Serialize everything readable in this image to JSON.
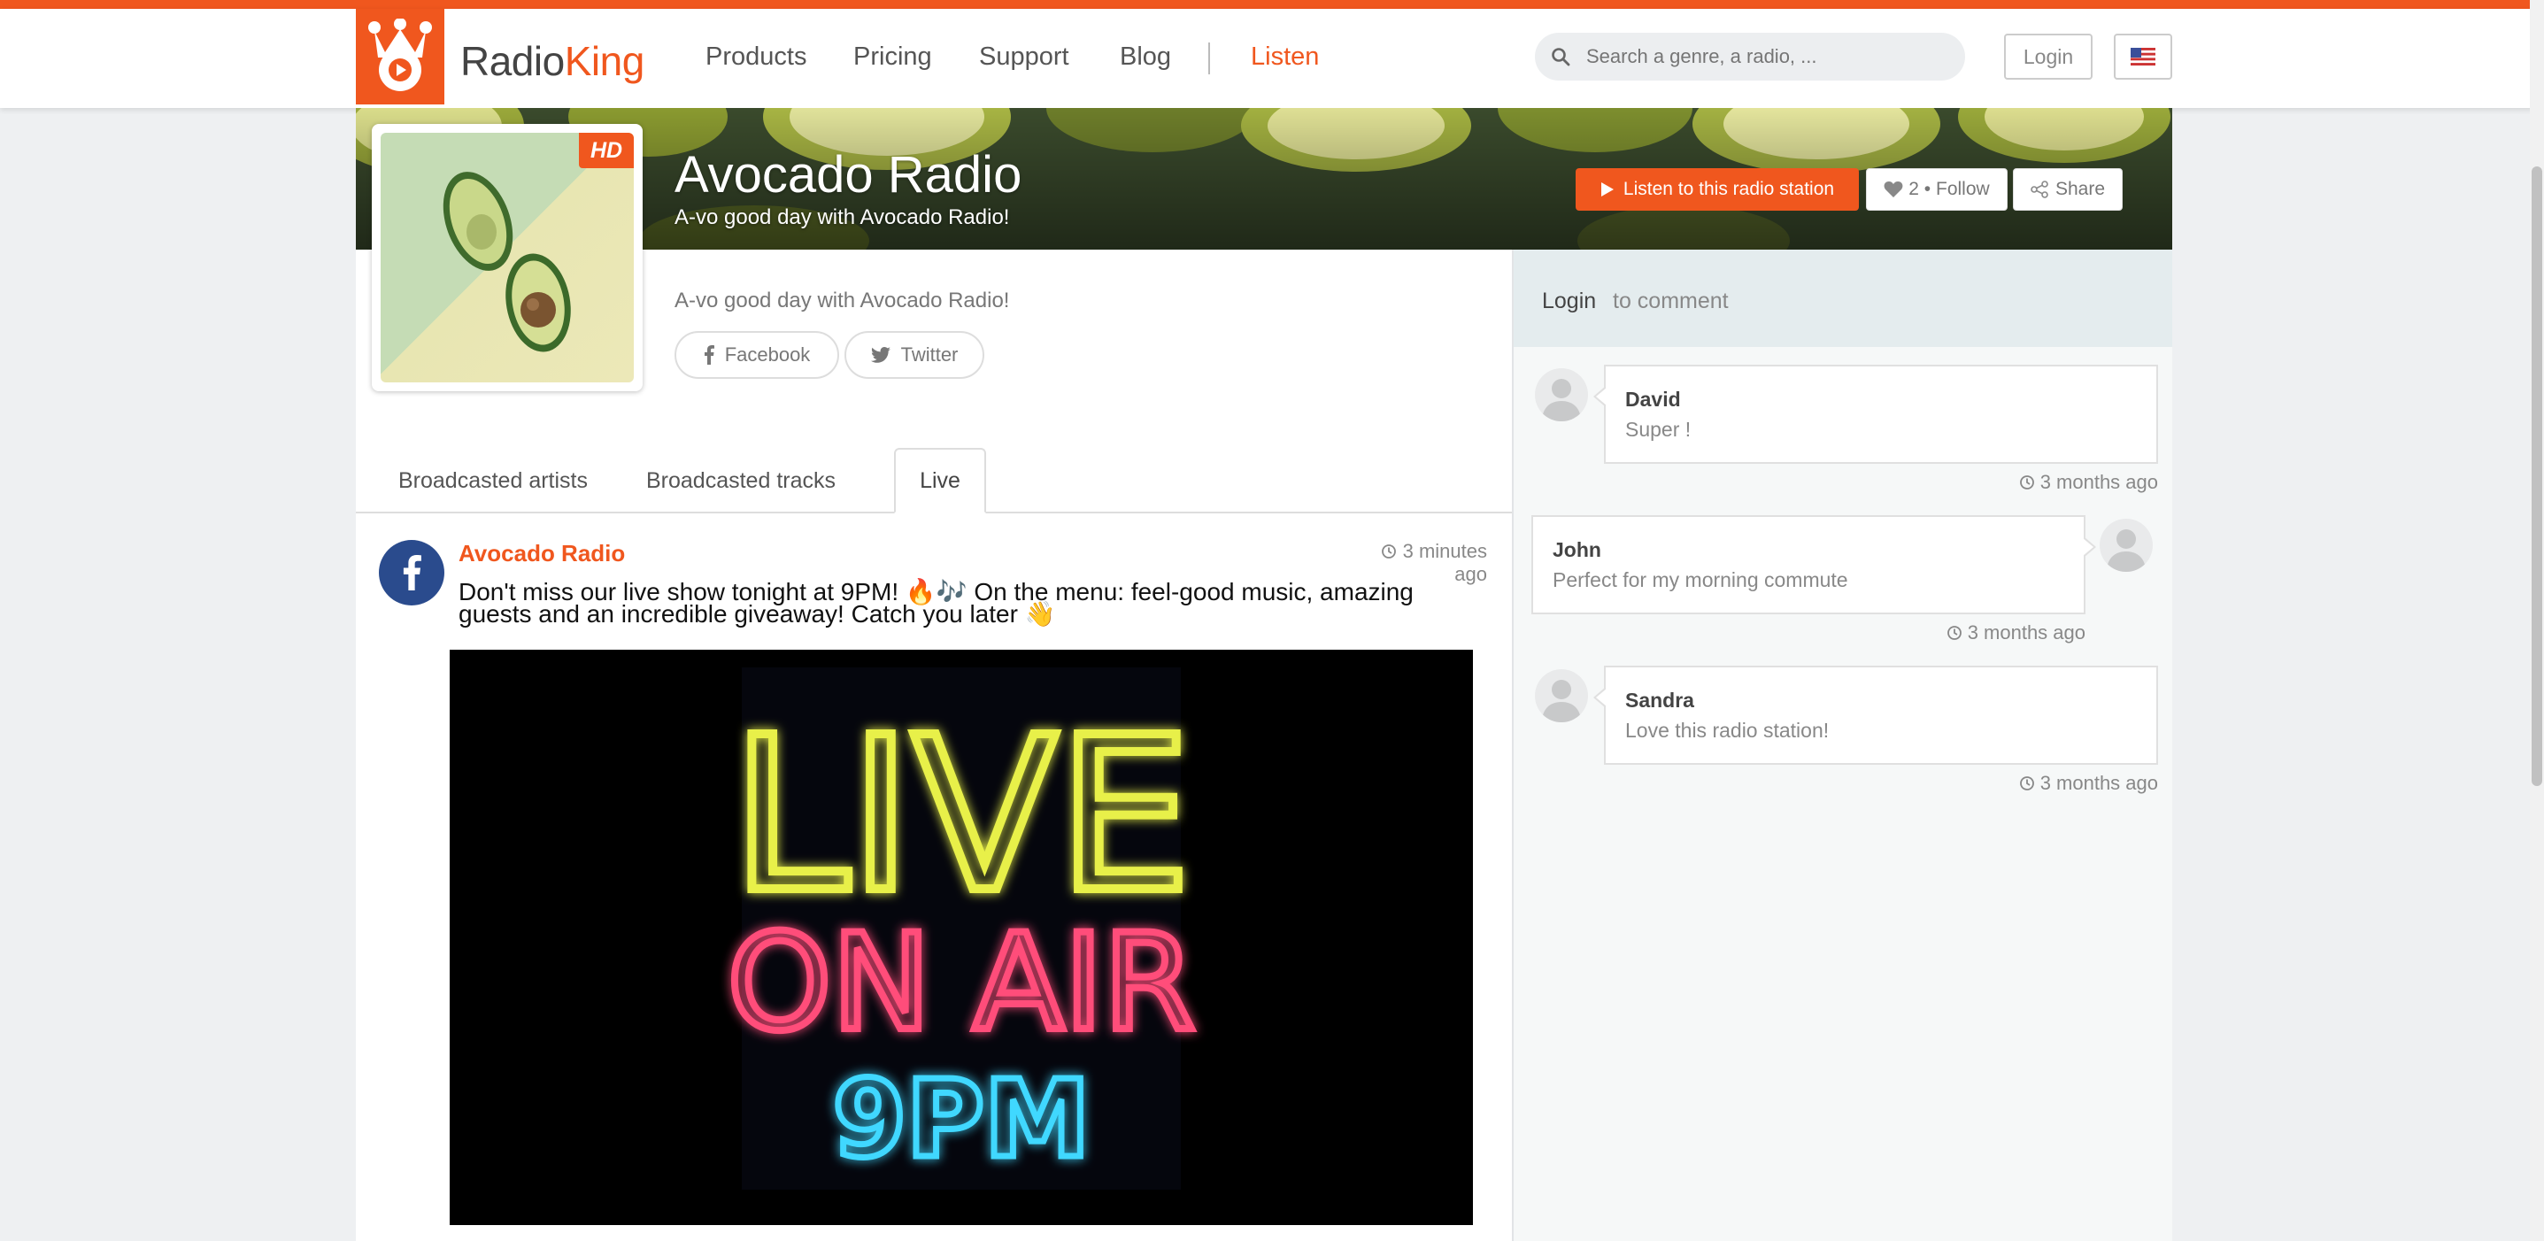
{
  "brand": {
    "part1": "Radio",
    "part2": "King",
    "accent": "#f0571e"
  },
  "nav": {
    "items": [
      {
        "label": "Products"
      },
      {
        "label": "Pricing"
      },
      {
        "label": "Support"
      },
      {
        "label": "Blog"
      }
    ],
    "listen": "Listen",
    "search_placeholder": "Search a genre, a radio, ...",
    "login": "Login"
  },
  "station": {
    "title": "Avocado Radio",
    "subtitle": "A-vo good day with Avocado Radio!",
    "hd": "HD",
    "listen_button": "Listen to this radio station",
    "follow_button": "2 • Follow",
    "share_button": "Share",
    "description": "A-vo good day with Avocado Radio!",
    "social": [
      {
        "label": "Facebook",
        "icon": "facebook-icon"
      },
      {
        "label": "Twitter",
        "icon": "twitter-icon"
      }
    ]
  },
  "tabs": [
    {
      "label": "Broadcasted artists",
      "active": false
    },
    {
      "label": "Broadcasted tracks",
      "active": false
    },
    {
      "label": "Live",
      "active": true
    }
  ],
  "post": {
    "author": "Avocado Radio",
    "time": "3 minutes ago",
    "text": "Don't miss our live show tonight at 9PM! 🔥🎶 On the menu: feel-good music, amazing guests and an incredible giveaway!  Catch you later 👋",
    "image": {
      "line1": "LIVE",
      "line2": "ON AIR",
      "line3": "9PM"
    }
  },
  "sidebar": {
    "login": "Login",
    "to_comment": "to comment",
    "comments": [
      {
        "name": "David",
        "text": "Super !",
        "time": "3 months ago",
        "side": "left"
      },
      {
        "name": "John",
        "text": "Perfect for my morning commute",
        "time": "3 months ago",
        "side": "right"
      },
      {
        "name": "Sandra",
        "text": "Love this radio station!",
        "time": "3 months ago",
        "side": "left"
      }
    ]
  }
}
